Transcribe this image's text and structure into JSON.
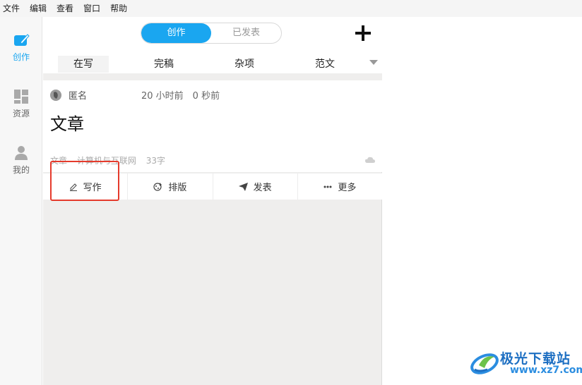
{
  "menubar": {
    "items": [
      "文件",
      "编辑",
      "查看",
      "窗口",
      "帮助"
    ]
  },
  "sidebar": {
    "items": [
      {
        "label": "创作",
        "icon": "edit-square-icon",
        "active": true
      },
      {
        "label": "资源",
        "icon": "grid-icon",
        "active": false
      },
      {
        "label": "我的",
        "icon": "user-icon",
        "active": false
      }
    ]
  },
  "topbar": {
    "segment": {
      "create": "创作",
      "published": "已发表"
    },
    "add_icon": "plus-icon"
  },
  "tabs": [
    "在写",
    "完稿",
    "杂项",
    "范文"
  ],
  "card": {
    "author": "匿名",
    "time": "20 小时前　0 秒前",
    "title": "文章",
    "tags": [
      "文章",
      "计算机与互联网",
      "33字"
    ]
  },
  "actions": {
    "write": "写作",
    "layout": "排版",
    "publish": "发表",
    "more": "更多"
  },
  "watermark": {
    "text": "极光下载站",
    "url": "www.xz7.com"
  },
  "colors": {
    "accent": "#1aa6f0",
    "highlight": "#e53b2c",
    "watermark": "#1d6fc2"
  }
}
